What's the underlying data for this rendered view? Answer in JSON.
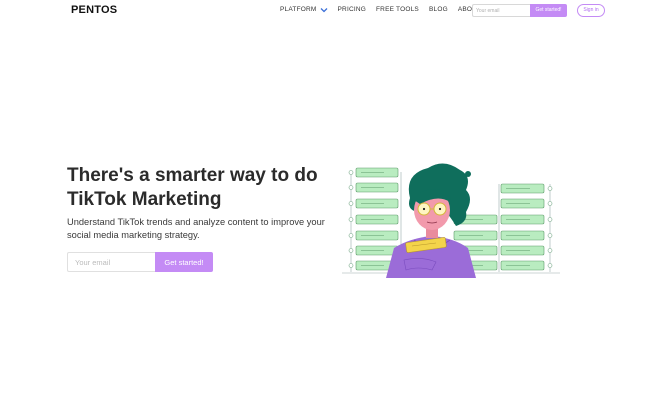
{
  "nav": {
    "logo": "PENTOS",
    "links": [
      "PLATFORM",
      "PRICING",
      "FREE TOOLS",
      "BLOG",
      "ABOUT"
    ],
    "email_placeholder": "Your email",
    "cta_label": "Get started!",
    "signin_label": "Sign in"
  },
  "hero": {
    "title": "There's a smarter way to do TikTok Marketing",
    "subtitle": "Understand TikTok trends and analyze content to improve your social media marketing strategy.",
    "email_placeholder": "Your email",
    "cta_label": "Get started!"
  },
  "colors": {
    "accent": "#c48bf5",
    "server_green": "#b9ecc0",
    "hair": "#0f6e5c",
    "shirt": "#9b6cd8",
    "badge": "#f3d44a"
  },
  "icons": [
    "chevron-down-icon"
  ]
}
